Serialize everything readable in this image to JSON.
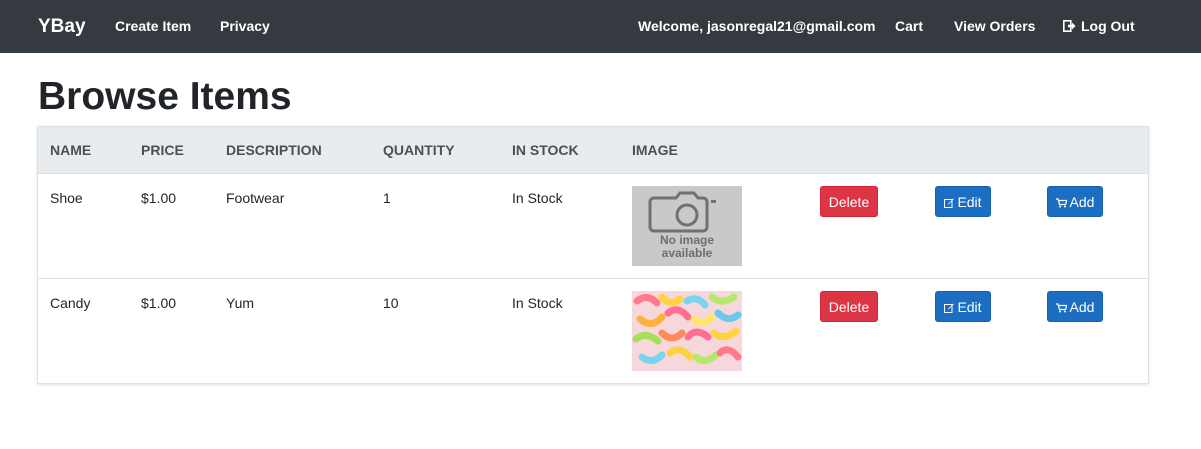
{
  "nav": {
    "brand": "YBay",
    "create_item": "Create Item",
    "privacy": "Privacy",
    "welcome": "Welcome, jasonregal21@gmail.com",
    "cart": "Cart",
    "view_orders": "View Orders",
    "logout": "Log Out"
  },
  "page": {
    "title": "Browse Items"
  },
  "table": {
    "headers": [
      "Name",
      "Price",
      "Description",
      "Quantity",
      "In Stock",
      "Image"
    ],
    "rows": [
      {
        "name": "Shoe",
        "price": "$1.00",
        "description": "Footwear",
        "quantity": "1",
        "in_stock": "In Stock",
        "image": "no-image-placeholder",
        "placeholder_text_1": "No image",
        "placeholder_text_2": "available"
      },
      {
        "name": "Candy",
        "price": "$1.00",
        "description": "Yum",
        "quantity": "10",
        "in_stock": "In Stock",
        "image": "gummy-worms-photo"
      }
    ],
    "actions": {
      "delete": "Delete",
      "edit": "Edit",
      "add": "Add"
    }
  },
  "colors": {
    "navbar": "#343a40",
    "header_bg": "#e9ecef",
    "danger": "#dc3545",
    "primary": "#1b6ec2"
  }
}
